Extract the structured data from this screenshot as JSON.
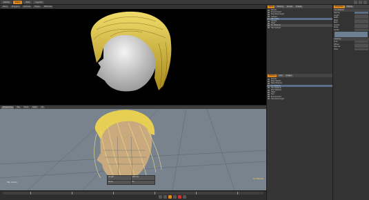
{
  "menubar": {
    "items": [
      "Model",
      "Paint",
      "Edit",
      "Layout"
    ],
    "active_index": 1,
    "accent_color": "#e08a1e"
  },
  "subbar": {
    "items": [
      "Items",
      "Polygons",
      "Vertices",
      "Edges",
      "Materials"
    ]
  },
  "viewport_bottom": {
    "tabs": [
      "Perspective",
      "Top",
      "Front",
      "Right",
      "UV"
    ],
    "active_tab": 0,
    "label": "Hair Guides",
    "corner_info": "Fur Material"
  },
  "hud": {
    "cells": [
      "Length",
      "100 mm",
      "Strips",
      "On"
    ]
  },
  "outliner": {
    "tabs": [
      "Items",
      "Shading",
      "Groups",
      "Images"
    ],
    "active_tab": 0,
    "rows": [
      "Render",
      "Environment",
      "Directional Light",
      "Camera",
      "Hair Mesh",
      "Guides",
      "Head",
      "Fur Material",
      "Hair Surface"
    ]
  },
  "shader_tree": {
    "tabs": [
      "Shading",
      "Lists",
      "Images"
    ],
    "active_tab": 0,
    "rows": [
      "Render",
      "Base Shader",
      "Base Material",
      "Fur Material",
      "Hair Material",
      "Skin Material",
      "Head",
      "Hair",
      "Environment",
      "Directional Light"
    ]
  },
  "properties": {
    "tabs": [
      "Properties",
      "Display"
    ],
    "active_tab": 0,
    "section_title": "Fur Material",
    "fields": [
      "Spacing",
      "Length",
      "Width",
      "Taper",
      "Bend",
      "Clumps",
      "Strips",
      "Guides"
    ],
    "section2_title": "Shading",
    "fields2": [
      "Color",
      "Diffuse",
      "Specular",
      "Gloss"
    ]
  }
}
